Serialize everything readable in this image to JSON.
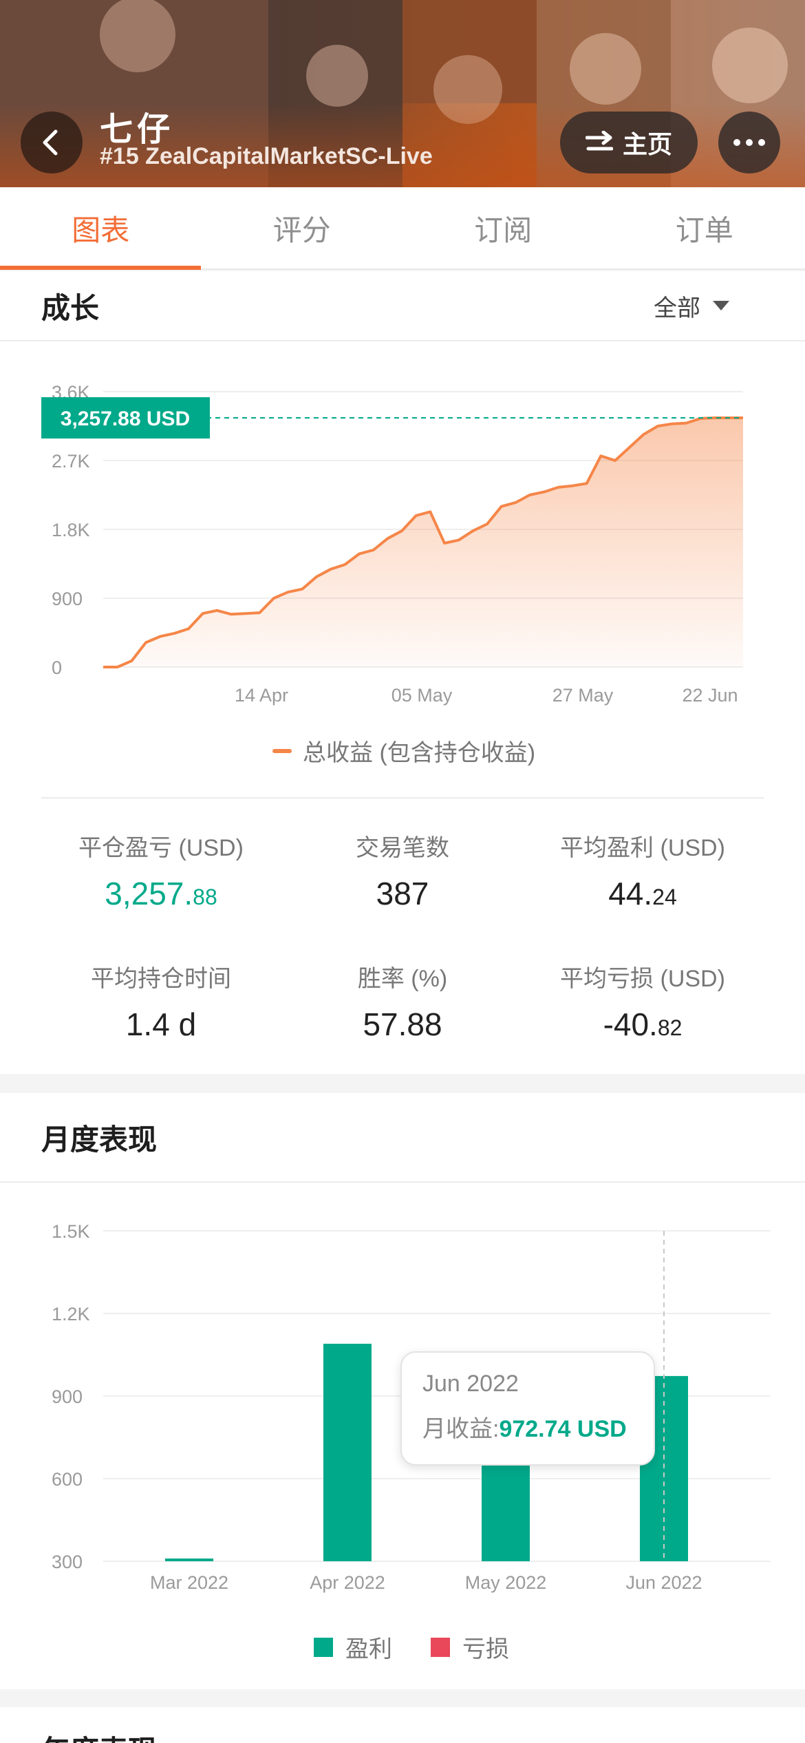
{
  "header": {
    "title": "七仔",
    "subtitle": "#15 ZealCapitalMarketSC-Live",
    "home_label": "主页",
    "back_icon": "chevron-left-icon",
    "more_icon": "more-horizontal-icon"
  },
  "tabs": [
    {
      "label": "图表",
      "active": true
    },
    {
      "label": "评分",
      "active": false
    },
    {
      "label": "订阅",
      "active": false
    },
    {
      "label": "订单",
      "active": false
    }
  ],
  "growth": {
    "title": "成长",
    "filter_label": "全部",
    "current_label": "3,257.88 USD",
    "legend_label": "总收益 (包含持仓收益)",
    "stats": [
      {
        "label": "平仓盈亏 (USD)",
        "value_int": "3,257.",
        "value_dec": "88",
        "highlight": true
      },
      {
        "label": "交易笔数",
        "value_int": "387",
        "value_dec": "",
        "highlight": false
      },
      {
        "label": "平均盈利 (USD)",
        "value_int": "44.",
        "value_dec": "24",
        "highlight": false
      },
      {
        "label": "平均持仓时间",
        "value_int": "1.4 d",
        "value_dec": "",
        "highlight": false
      },
      {
        "label": "胜率 (%)",
        "value_int": "57.88",
        "value_dec": "",
        "highlight": false
      },
      {
        "label": "平均亏损 (USD)",
        "value_int": "-40.",
        "value_dec": "82",
        "highlight": false
      }
    ]
  },
  "monthly": {
    "title": "月度表现",
    "legend_profit": "盈利",
    "legend_loss": "亏损",
    "tooltip_date": "Jun 2022",
    "tooltip_label": "月收益:",
    "tooltip_value": "972.74 USD"
  },
  "next_section_title": "年度表现",
  "colors": {
    "accent": "#f36d36",
    "profit": "#00a98a",
    "loss": "#e8485a",
    "line": "#f58648"
  },
  "chart_data": [
    {
      "type": "area",
      "title": "",
      "x_ticks": [
        "14 Apr",
        "05 May",
        "27 May",
        "22 Jun"
      ],
      "y_ticks": [
        "0",
        "900",
        "1.8K",
        "2.7K",
        "3.6K"
      ],
      "ylim": [
        0,
        3600
      ],
      "series": [
        {
          "name": "总收益 (包含持仓收益)",
          "x": [
            "Mar 28",
            "Mar 30",
            "Apr 1",
            "Apr 3",
            "Apr 5",
            "Apr 7",
            "Apr 9",
            "Apr 11",
            "Apr 13",
            "Apr 15",
            "Apr 17",
            "Apr 19",
            "Apr 21",
            "Apr 23",
            "Apr 25",
            "Apr 27",
            "Apr 29",
            "May 1",
            "May 3",
            "May 5",
            "May 7",
            "May 9",
            "May 11",
            "May 13",
            "May 14",
            "May 15",
            "May 17",
            "May 19",
            "May 21",
            "May 23",
            "May 25",
            "May 27",
            "May 29",
            "May 31",
            "Jun 2",
            "Jun 4",
            "Jun 6",
            "Jun 8",
            "Jun 10",
            "Jun 12",
            "Jun 14",
            "Jun 16",
            "Jun 18",
            "Jun 20",
            "Jun 22",
            "Jun 24"
          ],
          "values": [
            0,
            0,
            80,
            320,
            400,
            440,
            500,
            700,
            740,
            690,
            700,
            710,
            900,
            980,
            1020,
            1180,
            1280,
            1340,
            1480,
            1530,
            1680,
            1780,
            1980,
            2030,
            1620,
            1660,
            1780,
            1870,
            2100,
            2150,
            2250,
            2290,
            2350,
            2370,
            2400,
            2760,
            2700,
            2870,
            3040,
            3150,
            3180,
            3190,
            3250,
            3257.88,
            3257.88,
            3257.88
          ]
        }
      ]
    },
    {
      "type": "bar",
      "title": "",
      "categories": [
        "Mar 2022",
        "Apr 2022",
        "May 2022",
        "Jun 2022"
      ],
      "y_ticks": [
        "300",
        "600",
        "900",
        "1.2K",
        "1.5K"
      ],
      "ylim": [
        300,
        1500
      ],
      "series": [
        {
          "name": "盈利",
          "values": [
            305,
            1090,
            720,
            972.74
          ]
        },
        {
          "name": "亏损",
          "values": [
            0,
            0,
            0,
            0
          ]
        }
      ],
      "legend": "bottom"
    }
  ]
}
